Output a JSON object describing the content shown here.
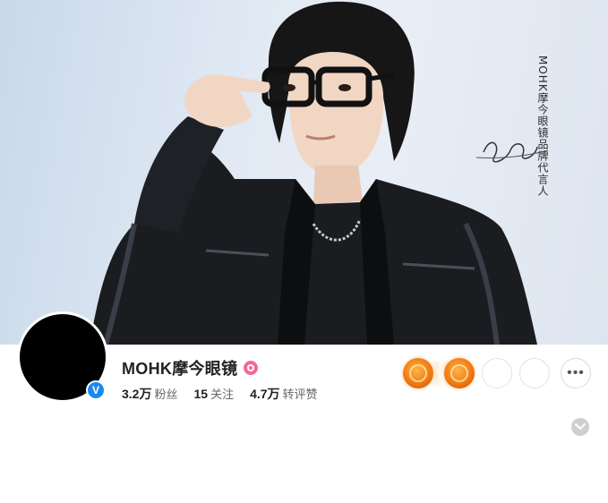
{
  "profile": {
    "name": "MOHK摩今眼镜",
    "stats": [
      {
        "value": "3.2万",
        "label": "粉丝"
      },
      {
        "value": "15",
        "label": "关注"
      },
      {
        "value": "4.7万",
        "label": "转评赞"
      }
    ],
    "verified": true
  },
  "cover": {
    "tagline": "MOHK摩今眼镜品牌代言人",
    "signature": "signature-scribble"
  },
  "actions": {
    "more_label": "•••",
    "icons": [
      "medal-icon",
      "medal-icon",
      "follow-button",
      "message-button",
      "more-icon",
      "chevron-down-icon"
    ]
  },
  "colors": {
    "verified_blue": "#1b88ee",
    "member_pink": "#f06a9b",
    "medal_orange": "#f07a12",
    "cover_bg": "#dfe8f3"
  }
}
